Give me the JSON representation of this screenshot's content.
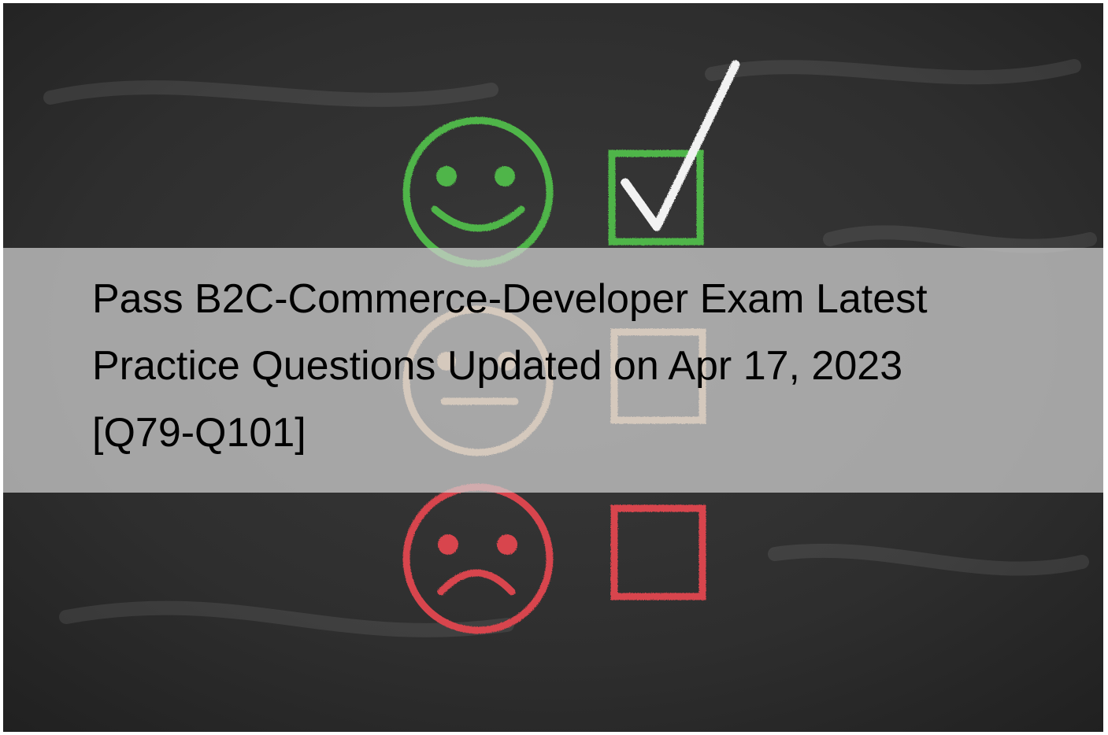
{
  "headline": {
    "line1": "Pass B2C-Commerce-Developer Exam Latest",
    "line2": "Practice Questions Updated on Apr 17, 2023",
    "line3": "[Q79-Q101]"
  },
  "image": {
    "rows": [
      {
        "face": "happy-face-icon",
        "box": "checked-box-icon",
        "color": "#4fb548"
      },
      {
        "face": "neutral-face-icon",
        "box": "empty-box-icon",
        "color": "#e9b98a"
      },
      {
        "face": "sad-face-icon",
        "box": "empty-box-icon",
        "color": "#d8454d"
      }
    ],
    "check_color": "#f2f2f2",
    "board_color": "#2c2c2c",
    "banner_color": "#cecece"
  }
}
